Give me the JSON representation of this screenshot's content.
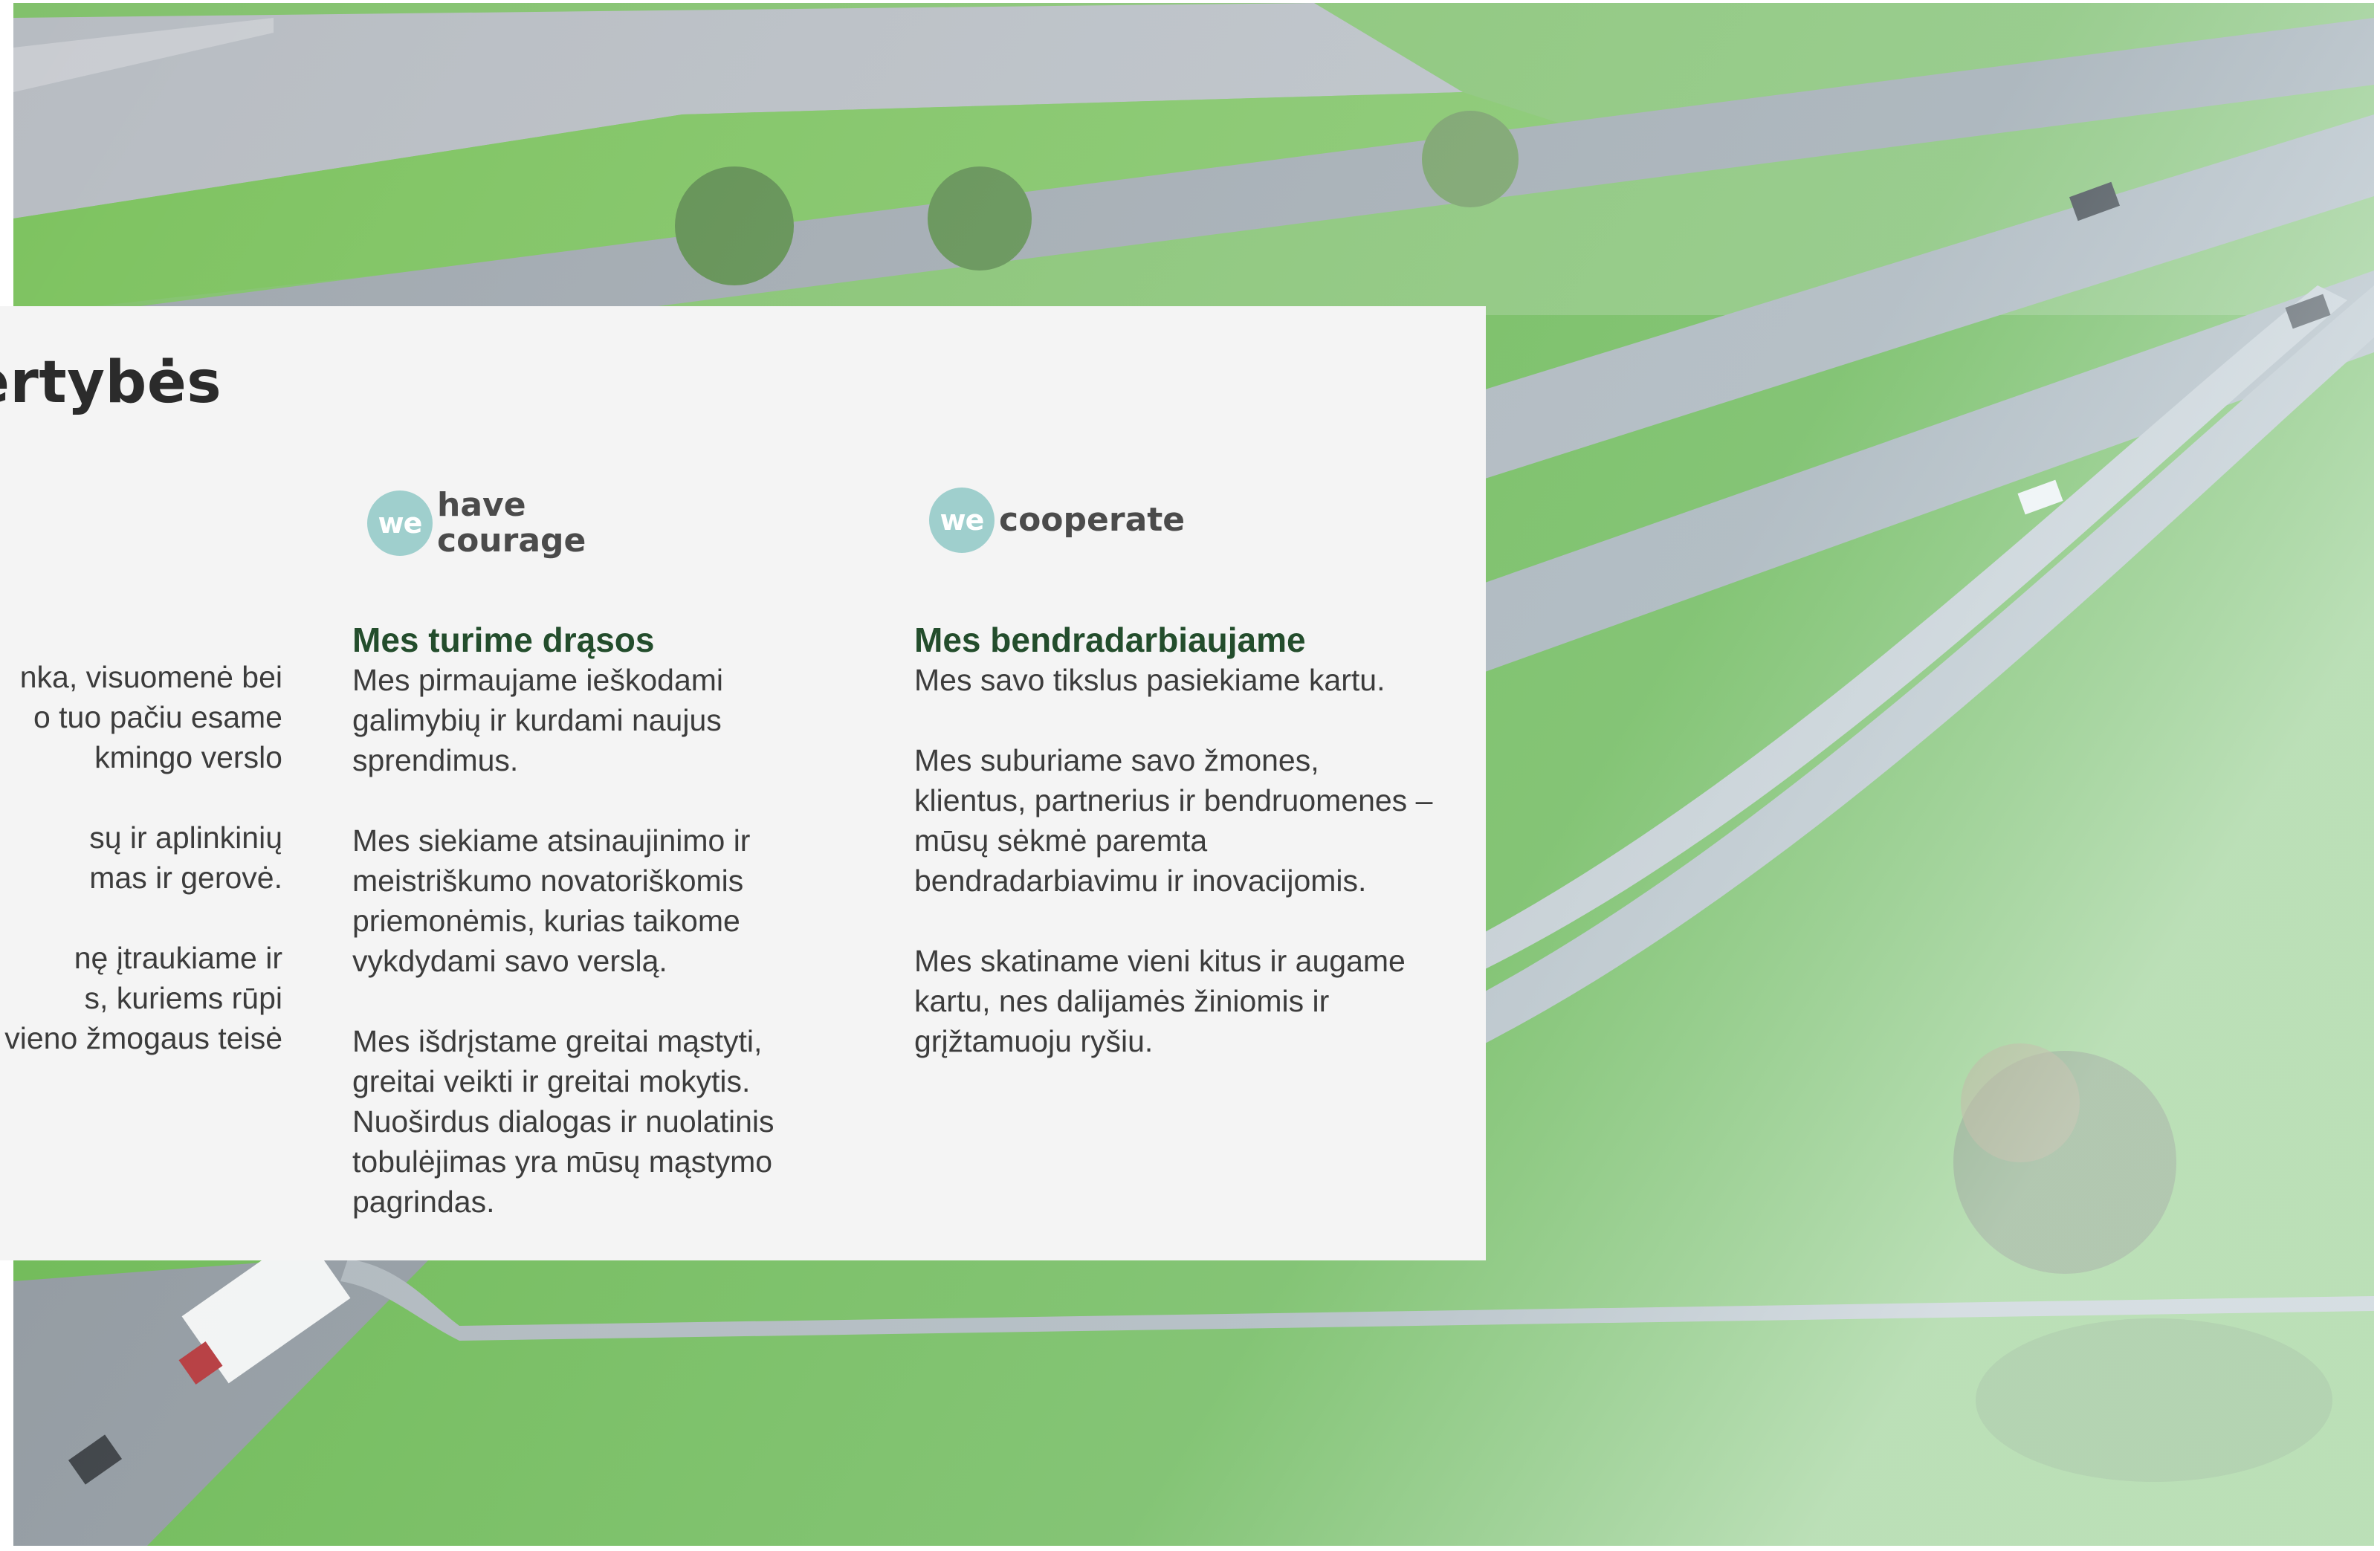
{
  "section": {
    "heading": "ertybės"
  },
  "left_fragment": {
    "paragraphs": [
      "nka, visuomenė bei\n o tuo pačiu esame\nkmingo verslo",
      "sų ir aplinkinių\nmas ir gerovė.",
      "nę įtraukiame ir\ns, kuriems rūpi\nvieno žmogaus teisė"
    ]
  },
  "values": [
    {
      "logo_badge": "we",
      "logo_text": "have\ncourage",
      "title": "Mes turime drąsos",
      "paragraphs": [
        "Mes pirmaujame ieškodami galimybių ir kurdami naujus sprendimus.",
        "Mes siekiame atsinaujinimo ir meistriškumo novatoriškomis priemonėmis, kurias taikome vykdydami savo verslą.",
        "Mes išdrįstame greitai mąstyti, greitai veikti ir greitai mokytis. Nuoširdus dialogas ir nuolatinis tobulėjimas yra mūsų mąstymo pagrindas."
      ]
    },
    {
      "logo_badge": "we",
      "logo_text": "cooperate",
      "title": "Mes bendradarbiaujame",
      "paragraphs": [
        "Mes savo tikslus pasiekiame kartu.",
        "Mes suburiame savo žmones, klientus, partnerius ir bendruomenes – mūsų sėkmė paremta bendradarbiavimu ir inovacijomis.",
        "Mes skatiname vieni kitus ir augame kartu, nes dalijamės žiniomis ir grįžtamuoju ryšiu."
      ]
    }
  ],
  "colors": {
    "card": "#f4f4f4",
    "title_green": "#234d2c",
    "badge": "#9fcfcd",
    "text": "#3c3c3c"
  }
}
